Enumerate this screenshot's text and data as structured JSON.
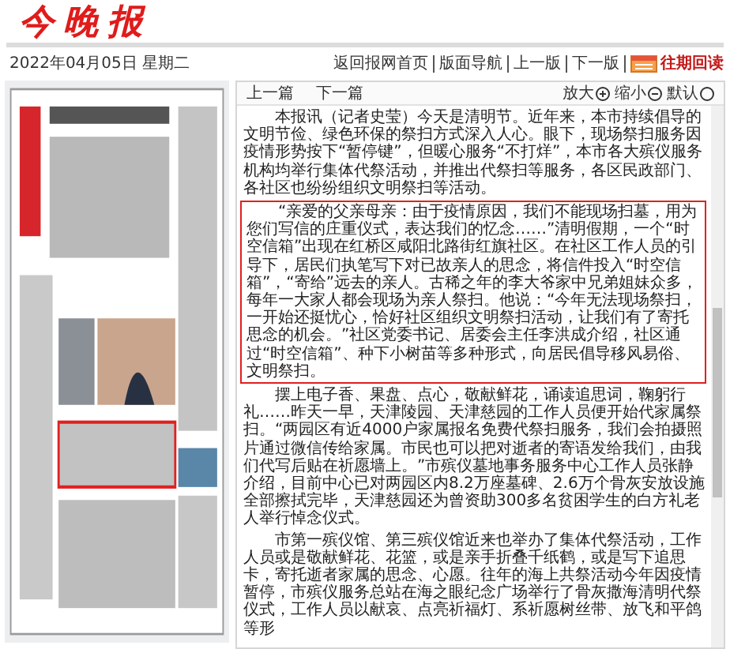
{
  "masthead": {
    "title": "今晚报"
  },
  "toolbar": {
    "date": "2022年04月05日 星期二",
    "links": [
      {
        "label": "返回报网首页"
      },
      {
        "label": "版面导航"
      },
      {
        "label": "上一版"
      },
      {
        "label": "下一版"
      }
    ],
    "archive": {
      "label": "往期回读"
    }
  },
  "article": {
    "nav": [
      {
        "label": "上一篇"
      },
      {
        "label": "下一篇"
      }
    ],
    "font_controls": [
      {
        "label": "放大",
        "kind": "plus"
      },
      {
        "label": "缩小",
        "kind": "minus"
      },
      {
        "label": "默认",
        "kind": "default"
      }
    ],
    "paragraphs": [
      {
        "text": "本报讯（记者史莹）今天是清明节。近年来，本市持续倡导的文明节俭、绿色环保的祭扫方式深入人心。眼下，现场祭扫服务因疫情形势按下“暂停键”，但暖心服务“不打烊”，本市各大殡仪服务机构均举行集体代祭活动，并推出代祭扫等服务，各区民政部门、各社区也纷纷组织文明祭扫等活动。",
        "highlighted": false
      },
      {
        "text": "“亲爱的父亲母亲：由于疫情原因，我们不能现场扫墓，用为您们写信的庄重仪式，表达我们的忆念……”清明假期，一个“时空信箱”出现在红桥区咸阳北路街红旗社区。在社区工作人员的引导下，居民们执笔写下对已故亲人的思念，将信件投入“时空信箱”，“寄给”远去的亲人。古稀之年的李大爷家中兄弟姐妹众多，每年一大家人都会现场为亲人祭扫。他说：“今年无法现场祭扫，一开始还挺忧心，恰好社区组织文明祭扫活动，让我们有了寄托思念的机会。”社区党委书记、居委会主任李洪成介绍，社区通过“时空信箱”、种下小树苗等多种形式，向居民倡导移风易俗、文明祭扫。",
        "highlighted": true
      },
      {
        "text": "摆上电子香、果盘、点心，敬献鲜花，诵读追思词，鞠躬行礼……昨天一早，天津陵园、天津慈园的工作人员便开始代家属祭扫。“两园区有近4000户家属报名免费代祭扫服务，我们会拍摄照片通过微信传给家属。市民也可以把对逝者的寄语发给我们，由我们代写后贴在祈愿墙上。”市殡仪墓地事务服务中心工作人员张静介绍，目前中心已对两园区内8.2万座墓碑、2.6万个骨灰安放设施全部擦拭完毕，天津慈园还为曾资助300多名贫困学生的白方礼老人举行悼念仪式。",
        "highlighted": false
      },
      {
        "text": "市第一殡仪馆、第三殡仪馆近来也举办了集体代祭活动，工作人员或是敬献鲜花、花篮，或是亲手折叠千纸鹤，或是写下追思卡，寄托逝者家属的思念、心愿。往年的海上共祭活动今年因疫情暂停，市殡仪服务总站在海之眼纪念广场举行了骨灰撒海清明代祭仪式，工作人员以献哀、点亮祈福灯、系祈愿树丝带、放飞和平鸽等形",
        "highlighted": false
      }
    ]
  }
}
